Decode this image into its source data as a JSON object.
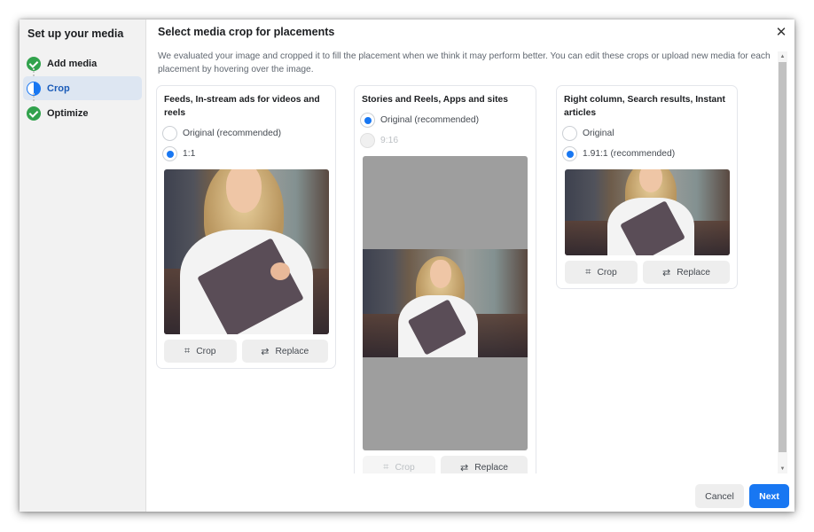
{
  "sidebar": {
    "title": "Set up your media",
    "steps": [
      {
        "label": "Add media",
        "status": "complete",
        "icon": "check-circle-icon"
      },
      {
        "label": "Crop",
        "status": "in-progress",
        "icon": "half-circle-icon"
      },
      {
        "label": "Optimize",
        "status": "complete",
        "icon": "check-circle-icon"
      }
    ]
  },
  "main": {
    "title": "Select media crop for placements",
    "description": "We evaluated your image and cropped it to fill the placement when we think it may perform better. You can edit these crops or upload new media for each placement by hovering over the image.",
    "close_icon": "close-icon"
  },
  "placements": [
    {
      "title": "Feeds, In-stream ads for videos and reels",
      "options": [
        {
          "label": "Original (recommended)",
          "checked": false,
          "disabled": false
        },
        {
          "label": "1:1",
          "checked": true,
          "disabled": false
        }
      ],
      "image_alt": "Smiling woman holding a menu folder in a restaurant",
      "crop_label": "Crop",
      "replace_label": "Replace",
      "crop_disabled": false
    },
    {
      "title": "Stories and Reels, Apps and sites",
      "options": [
        {
          "label": "Original (recommended)",
          "checked": true,
          "disabled": false
        },
        {
          "label": "9:16",
          "checked": false,
          "disabled": true
        }
      ],
      "image_alt": "Smiling woman holding a menu folder in a restaurant",
      "crop_label": "Crop",
      "replace_label": "Replace",
      "crop_disabled": true
    },
    {
      "title": "Right column, Search results, Instant articles",
      "options": [
        {
          "label": "Original",
          "checked": false,
          "disabled": false
        },
        {
          "label": "1.91:1 (recommended)",
          "checked": true,
          "disabled": false
        }
      ],
      "image_alt": "Smiling woman holding a menu folder in a restaurant",
      "crop_label": "Crop",
      "replace_label": "Replace",
      "crop_disabled": false
    }
  ],
  "icons": {
    "crop": "⌗",
    "replace": "⇄",
    "close": "✕",
    "scroll_up": "▲",
    "scroll_down": "▼"
  },
  "footer": {
    "cancel_label": "Cancel",
    "next_label": "Next"
  },
  "colors": {
    "accent": "#1877f2",
    "success": "#31a24c",
    "active_step_bg": "#dde6f2"
  }
}
